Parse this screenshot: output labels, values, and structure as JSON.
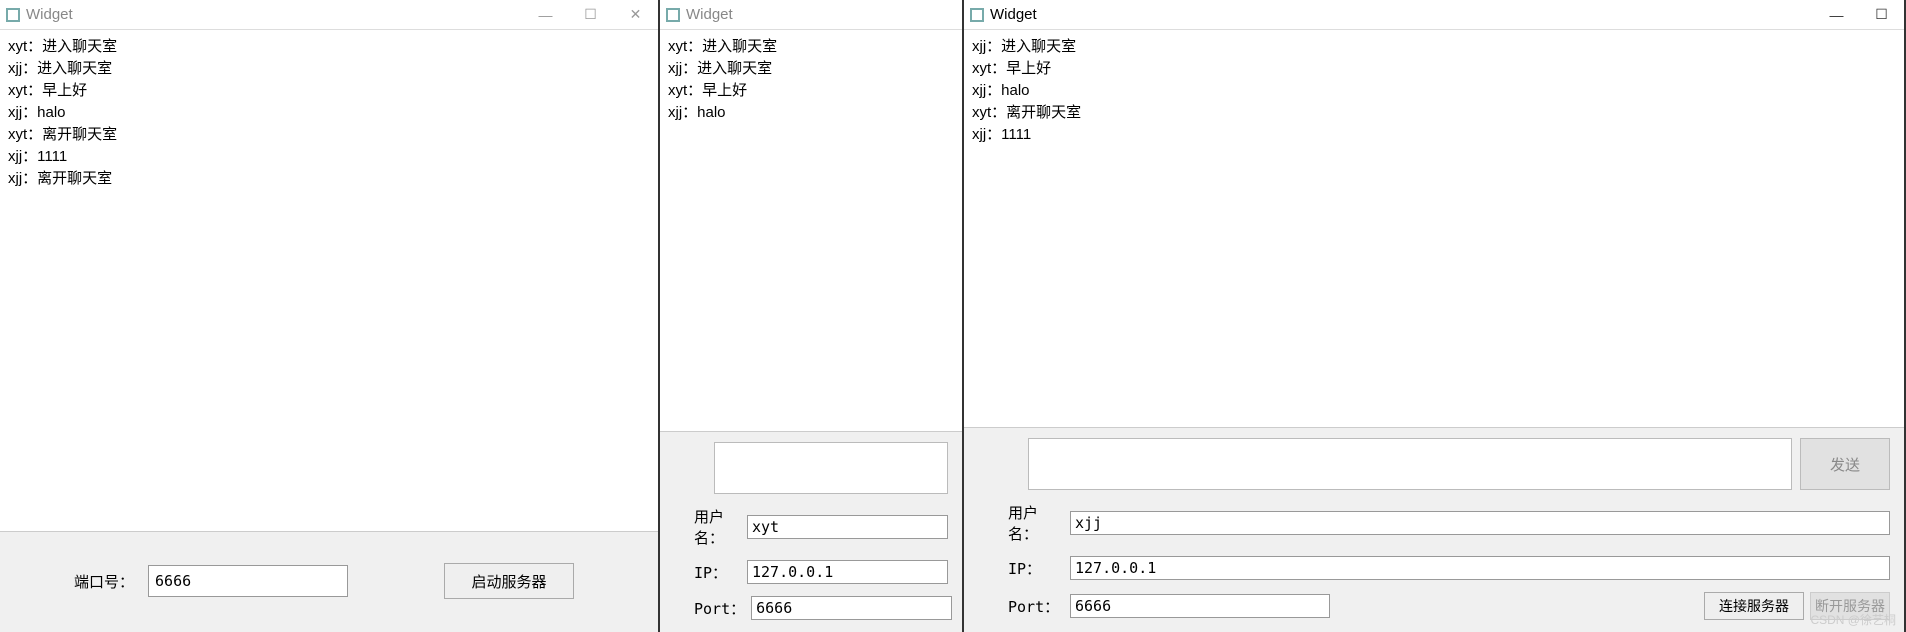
{
  "server": {
    "title": "Widget",
    "chat": [
      "xyt：进入聊天室",
      "xjj：进入聊天室",
      "xyt：早上好",
      "xjj：halo",
      "xyt：离开聊天室",
      "xjj：1111",
      "xjj：离开聊天室"
    ],
    "port_label": "端口号：",
    "port_value": "6666",
    "start_label": "启动服务器"
  },
  "client1": {
    "title": "Widget",
    "chat": [
      "xyt：进入聊天室",
      "xjj：进入聊天室",
      "xyt：早上好",
      "xjj：halo"
    ],
    "msg_value": "",
    "user_label": "用户名：",
    "user_value": "xyt",
    "ip_label": "IP：",
    "ip_value": "127.0.0.1",
    "port_label": "Port：",
    "port_value": "6666"
  },
  "client2": {
    "title": "Widget",
    "chat": [
      "xjj：进入聊天室",
      "xyt：早上好",
      "xjj：halo",
      "xyt：离开聊天室",
      "xjj：1111"
    ],
    "msg_value": "",
    "send_label": "发送",
    "user_label": "用户名：",
    "user_value": "xjj",
    "ip_label": "IP：",
    "ip_value": "127.0.0.1",
    "port_label": "Port：",
    "port_value": "6666",
    "connect_label": "连接服务器",
    "disconnect_label": "断开服务器"
  },
  "watermark": "CSDN @徐艺桐"
}
